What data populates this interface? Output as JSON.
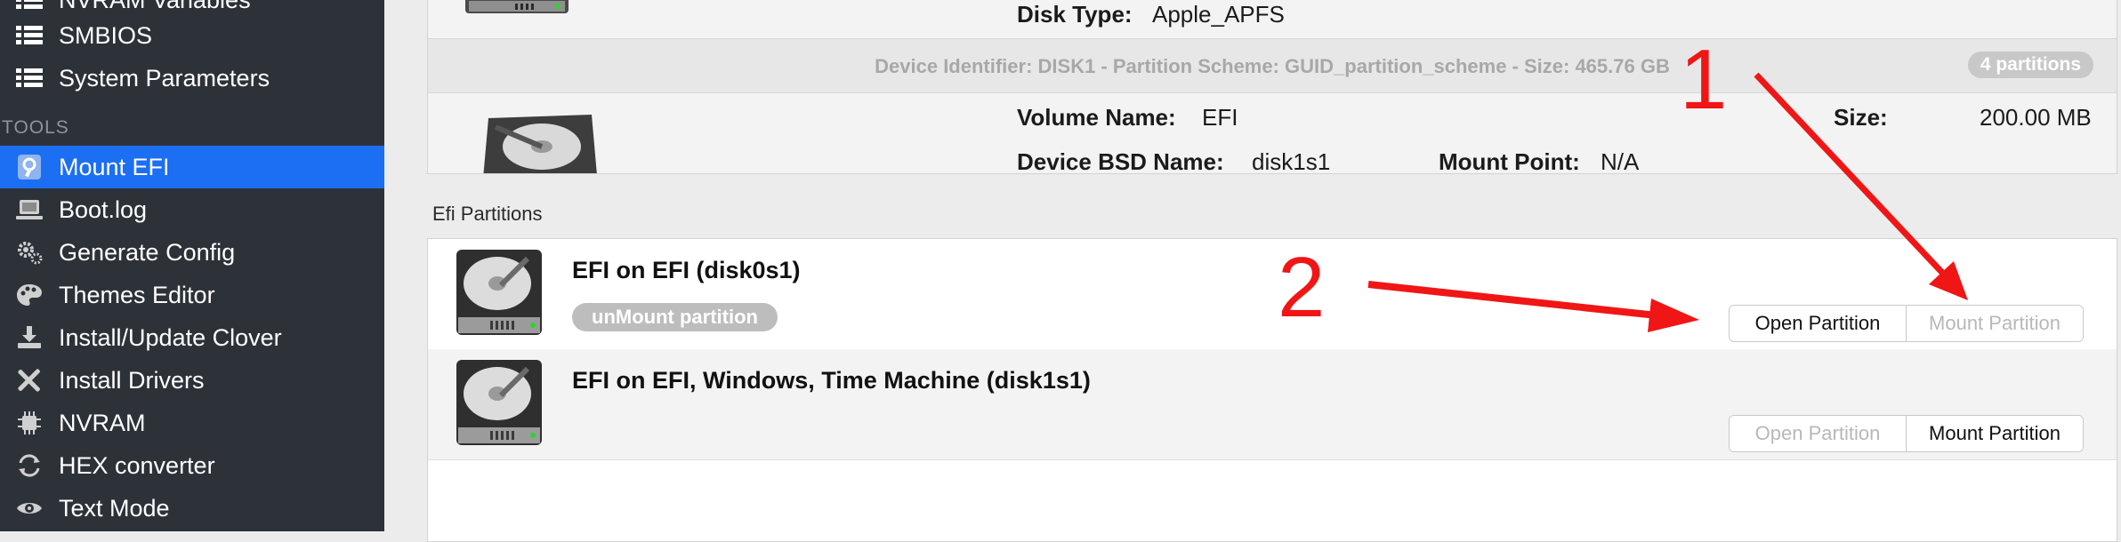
{
  "sidebar": {
    "section_tools": "TOOLS",
    "items": [
      {
        "label": "NVRAM Variables",
        "icon": "list-icon"
      },
      {
        "label": "SMBIOS",
        "icon": "list-icon"
      },
      {
        "label": "System Parameters",
        "icon": "list-icon"
      },
      {
        "label": "Mount EFI",
        "icon": "mount-efi-icon",
        "selected": true
      },
      {
        "label": "Boot.log",
        "icon": "laptop-icon"
      },
      {
        "label": "Generate Config",
        "icon": "gears-icon"
      },
      {
        "label": "Themes Editor",
        "icon": "palette-icon"
      },
      {
        "label": "Install/Update Clover",
        "icon": "download-icon"
      },
      {
        "label": "Install Drivers",
        "icon": "tools-icon"
      },
      {
        "label": "NVRAM",
        "icon": "chip-icon"
      },
      {
        "label": "HEX converter",
        "icon": "refresh-icon"
      },
      {
        "label": "Text Mode",
        "icon": "eye-icon"
      }
    ]
  },
  "disk": {
    "disk_type_label": "Disk Type:",
    "disk_type_value": "Apple_APFS",
    "device_identifier": "Device Identifier: DISK1 - Partition Scheme: GUID_partition_scheme - Size: 465.76 GB",
    "partitions_badge": "4 partitions",
    "volume_name_label": "Volume Name:",
    "volume_name_value": "EFI",
    "size_label": "Size:",
    "size_value": "200.00 MB",
    "bsd_name_label": "Device BSD Name:",
    "bsd_name_value": "disk1s1",
    "mount_point_label": "Mount Point:",
    "mount_point_value": "N/A"
  },
  "efi": {
    "section_title": "Efi Partitions",
    "partitions": [
      {
        "name": "EFI on EFI (disk0s1)",
        "badge": "unMount partition",
        "open_label": "Open Partition",
        "mount_label": "Mount Partition",
        "open_enabled": true,
        "mount_enabled": false
      },
      {
        "name": "EFI on EFI, Windows, Time Machine (disk1s1)",
        "badge": "",
        "open_label": "Open Partition",
        "mount_label": "Mount Partition",
        "open_enabled": false,
        "mount_enabled": true
      }
    ]
  },
  "annotations": {
    "marker_1": "1",
    "marker_2": "2",
    "color": "#f01616"
  },
  "colors": {
    "sidebar_bg": "#2d3239",
    "selection": "#1c6ef3"
  }
}
